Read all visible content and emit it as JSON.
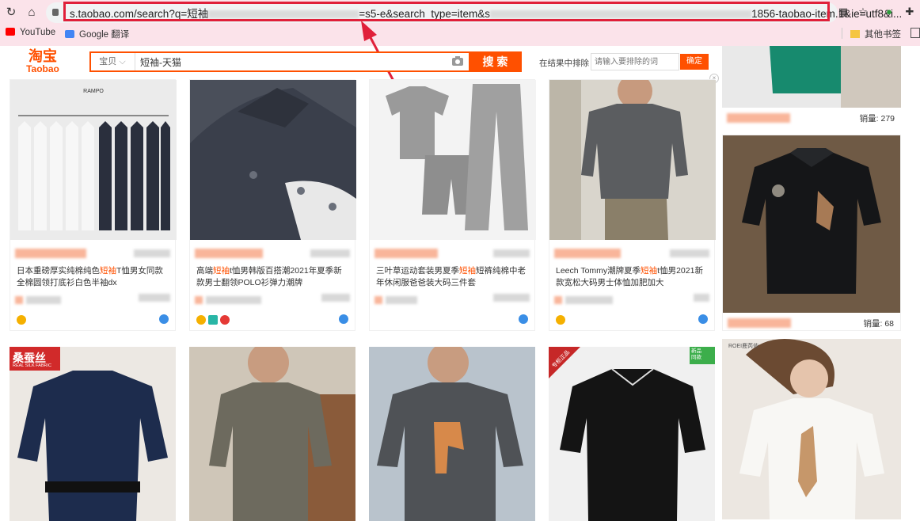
{
  "browser": {
    "url_prefix": "s.taobao.com/search?q=短袖",
    "url_mid": "=s5-e&search_type=item&s",
    "url_suffix": "1856-taobao-item.1&ie=utf8&i...",
    "bookmarks": [
      {
        "label": "YouTube",
        "icon": "youtube-icon",
        "color": "#ff0000"
      },
      {
        "label": "Google 翻译",
        "icon": "translate-icon",
        "color": "#4285f4"
      }
    ],
    "other_bookmarks": "其他书签",
    "highlight_color": "#e0203a"
  },
  "site": {
    "logo_cn": "淘宝",
    "logo_en": "Taobao",
    "accent": "#ff5000"
  },
  "search": {
    "scope": "宝贝",
    "query": "短袖-天猫",
    "button": "搜 索",
    "exclude_label": "在结果中排除",
    "exclude_placeholder": "请输入要排除的词",
    "exclude_button": "确定"
  },
  "products": [
    {
      "title_pre": "日本重磅厚实纯棉纯色",
      "title_hl": "短袖",
      "title_post": "T恤男女同款全棉圆领打底衫白色半袖dx"
    },
    {
      "title_pre": "高端",
      "title_hl": "短袖",
      "title_post": "t恤男韩版百搭潮2021年夏季新款男士翻领POLO衫弹力潮牌"
    },
    {
      "title_pre": "三叶草运动套装男夏季",
      "title_hl": "短袖",
      "title_post": "短裤纯棉中老年休闲服爸爸装大码三件套"
    },
    {
      "title_pre": "Leech Tommy潮牌夏季",
      "title_hl": "短袖",
      "title_post": "t恤男2021新款宽松大码男士体恤加肥加大"
    }
  ],
  "side_items": [
    {
      "sales": "销量: 279"
    },
    {
      "sales": "销量: 68"
    }
  ],
  "row2_badges": {
    "silk_brand": "桑蚕丝",
    "silk_sub": "REAL SILK FABRIC",
    "counter": "专柜正品",
    "new_tag": "新品\n同款",
    "brand_roei": "ROEI鹿芮依"
  }
}
